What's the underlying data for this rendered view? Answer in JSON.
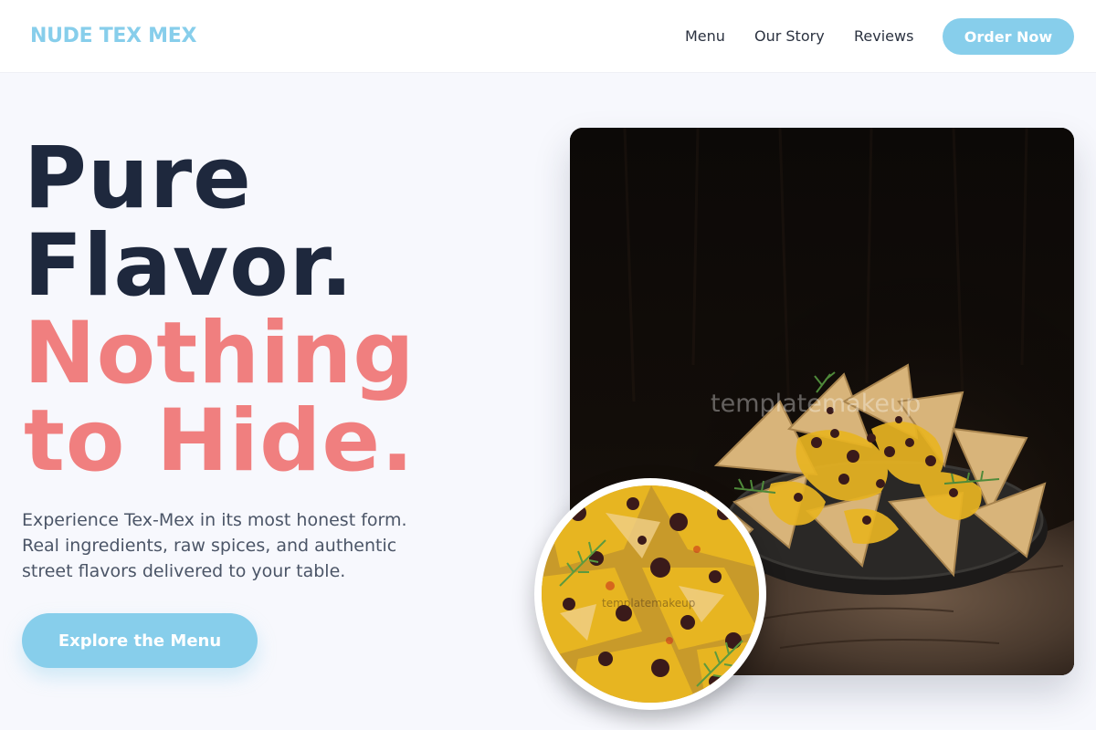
{
  "header": {
    "logo": "NUDE TEX MEX",
    "nav": [
      "Menu",
      "Our Story",
      "Reviews"
    ],
    "cta": "Order Now"
  },
  "hero": {
    "headline_dark": [
      "Pure",
      "Flavor."
    ],
    "headline_accent": [
      "Nothing",
      "to Hide."
    ],
    "subtext_lines": [
      "Experience Tex-Mex in its most honest form.",
      "Real ingredients, raw spices, and authentic",
      "street flavors delivered to your table."
    ],
    "cta": "Explore the Menu"
  },
  "images": {
    "main_watermark": "templatemakeup",
    "circle_watermark": "templatemakeup",
    "main_image_name": "nachos-on-wooden-stump-photo",
    "circle_image_name": "nachos-closeup-photo"
  },
  "colors": {
    "accent": "#87ceeb",
    "headline_dark": "#1e283d",
    "headline_accent": "#f07f7f",
    "background": "#f7f8fd"
  }
}
